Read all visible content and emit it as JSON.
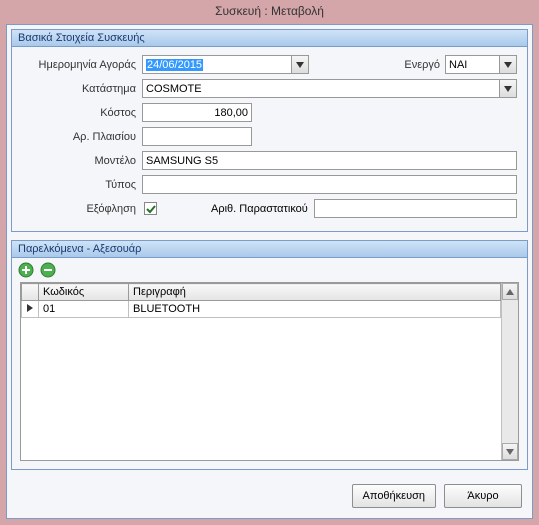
{
  "window": {
    "title": "Συσκευή : Μεταβολή"
  },
  "panel_basic": {
    "header": "Βασικά Στοιχεία Συσκευής",
    "labels": {
      "purchase_date": "Ημερομηνία Αγοράς",
      "active": "Ενεργό",
      "store": "Κατάστημα",
      "cost": "Κόστος",
      "chassis_no": "Αρ. Πλαισίου",
      "model": "Μοντέλο",
      "type": "Τύπος",
      "paid_off": "Εξόφληση",
      "receipt_no": "Αριθ. Παραστατικού"
    },
    "values": {
      "purchase_date": "24/06/2015",
      "active": "ΝΑΙ",
      "store": "COSMOTE",
      "cost": "180,00",
      "chassis_no": "",
      "model": "SAMSUNG S5",
      "type": "",
      "paid_off": true,
      "receipt_no": ""
    }
  },
  "panel_accessories": {
    "header": "Παρελκόμενα - Αξεσουάρ",
    "columns": {
      "code": "Κωδικός",
      "description": "Περιγραφή"
    },
    "rows": [
      {
        "code": "01",
        "description": "BLUETOOTH"
      }
    ]
  },
  "buttons": {
    "save": "Αποθήκευση",
    "cancel": "Άκυρο"
  },
  "colors": {
    "accent": "#3399ff",
    "border": "#7a9cc6",
    "bg": "#d4a5a9"
  }
}
